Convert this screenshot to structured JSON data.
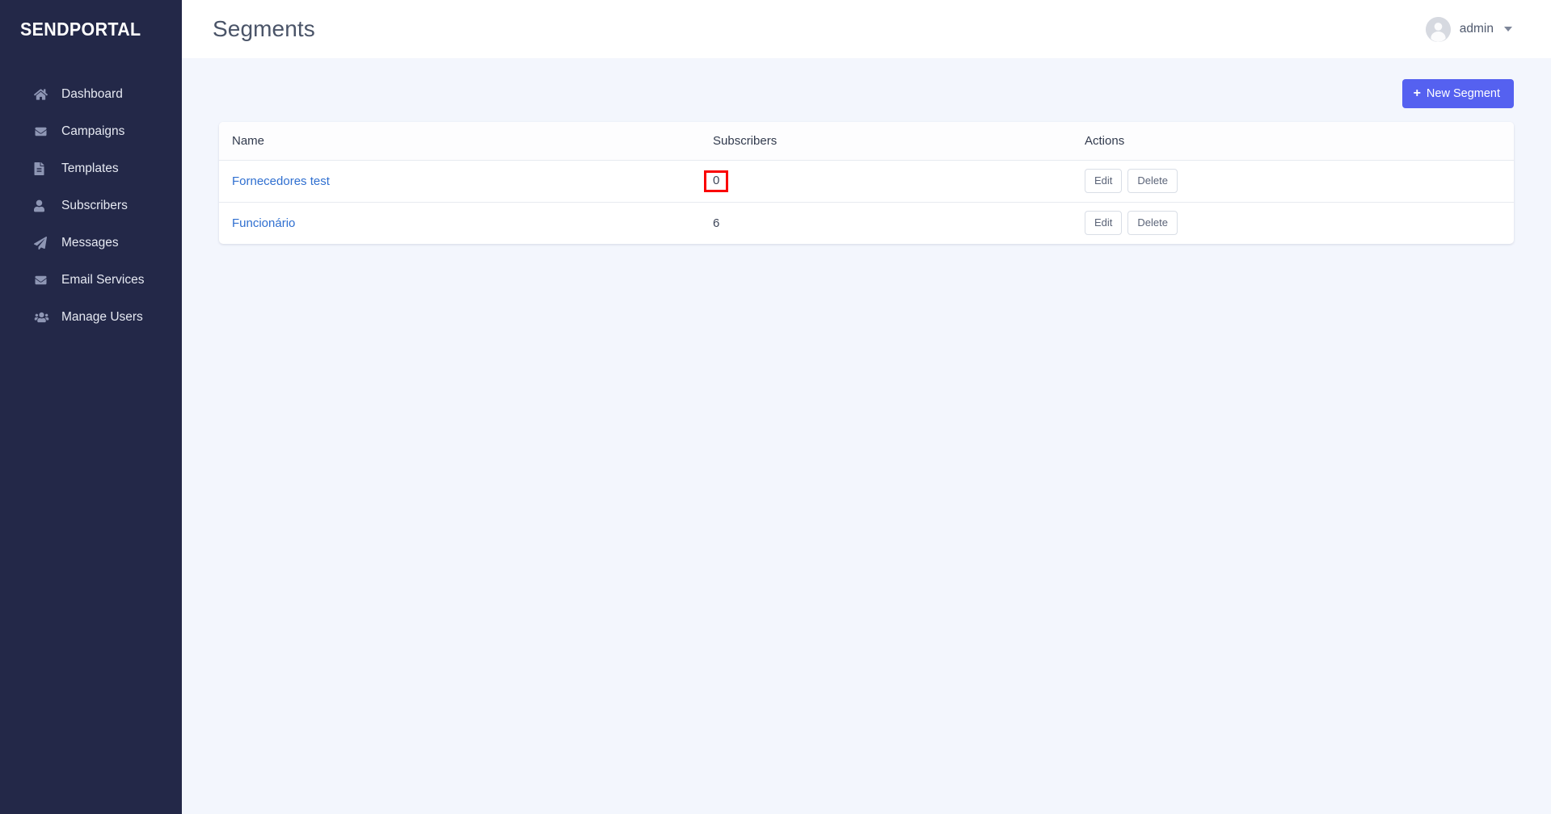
{
  "brand": {
    "name": "SENDPORTAL"
  },
  "sidebar": {
    "items": [
      {
        "label": "Dashboard",
        "icon": "home-icon"
      },
      {
        "label": "Campaigns",
        "icon": "envelope-icon"
      },
      {
        "label": "Templates",
        "icon": "document-icon"
      },
      {
        "label": "Subscribers",
        "icon": "user-icon"
      },
      {
        "label": "Messages",
        "icon": "paper-plane-icon"
      },
      {
        "label": "Email Services",
        "icon": "envelope-icon"
      },
      {
        "label": "Manage Users",
        "icon": "users-icon"
      }
    ]
  },
  "header": {
    "title": "Segments",
    "user": {
      "name": "admin",
      "avatar": "user-avatar-icon",
      "caret": "chevron-down-icon"
    }
  },
  "toolbar": {
    "new_segment_label": "New Segment",
    "new_segment_icon": "plus-icon"
  },
  "table": {
    "columns": [
      "Name",
      "Subscribers",
      "Actions"
    ],
    "rows": [
      {
        "name": "Fornecedores test",
        "subscribers": "0",
        "highlighted": true,
        "edit_label": "Edit",
        "delete_label": "Delete"
      },
      {
        "name": "Funcionário",
        "subscribers": "6",
        "highlighted": false,
        "edit_label": "Edit",
        "delete_label": "Delete"
      }
    ]
  },
  "colors": {
    "sidebar_bg": "#232848",
    "page_bg": "#f3f6fd",
    "accent": "#5561f0",
    "link": "#2f6fd0",
    "highlight_outline": "#fa0000"
  }
}
